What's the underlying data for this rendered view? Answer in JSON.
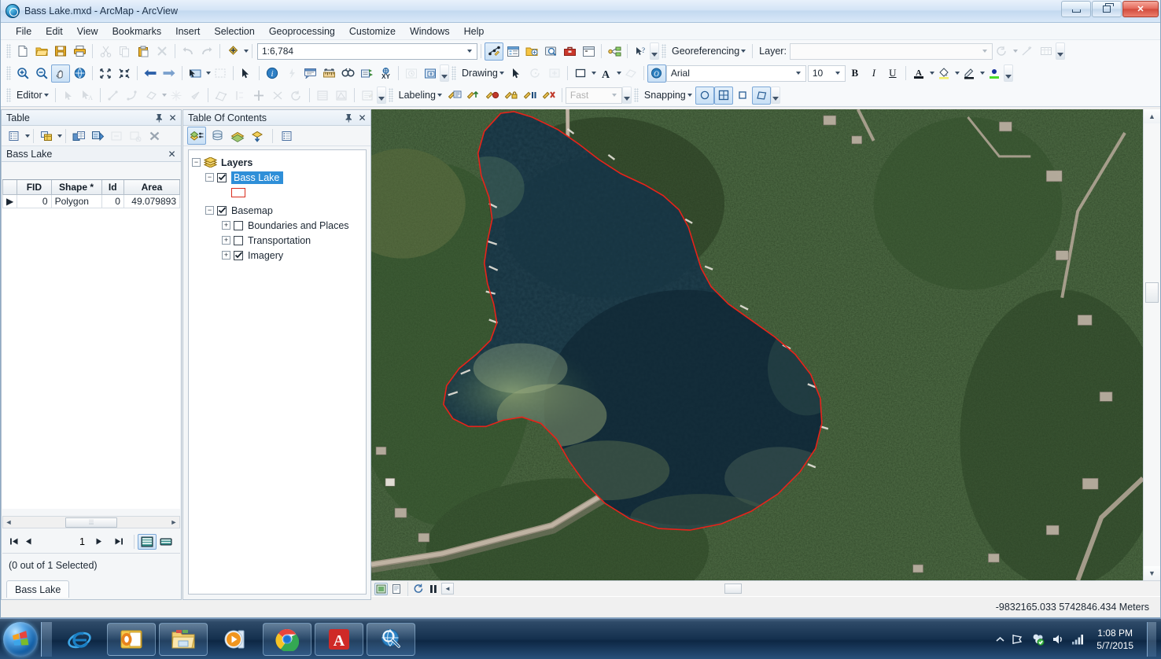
{
  "window": {
    "title": "Bass Lake.mxd - ArcMap - ArcView",
    "icon": "arcmap-globe-icon",
    "minimize_label": "Minimize",
    "maximize_label": "Restore",
    "close_label": "Close"
  },
  "menu": {
    "items": [
      "File",
      "Edit",
      "View",
      "Bookmarks",
      "Insert",
      "Selection",
      "Geoprocessing",
      "Customize",
      "Windows",
      "Help"
    ]
  },
  "toolbars": {
    "standard": {
      "scale_value": "1:6,784",
      "buttons": [
        "new-map-icon",
        "open-icon",
        "save-icon",
        "print-icon",
        "cut-icon",
        "copy-icon",
        "paste-icon",
        "delete-icon",
        "undo-icon",
        "redo-icon",
        "add-data-icon"
      ],
      "after_scale": [
        "editor-toolbar-icon",
        "table-of-contents-icon",
        "catalog-icon",
        "search-icon",
        "arctoolbox-icon",
        "python-window-icon",
        "model-builder-icon",
        "whats-this-icon"
      ]
    },
    "georeferencing": {
      "label": "Georeferencing",
      "layer_label": "Layer:",
      "layer_value": "",
      "buttons": [
        "rotate-icon",
        "link-icon",
        "link-table-icon"
      ]
    },
    "tools": {
      "buttons": [
        "zoom-in-icon",
        "zoom-out-icon",
        "pan-icon",
        "full-extent-icon",
        "fixed-zoom-in-icon",
        "fixed-zoom-out-icon",
        "go-back-icon",
        "go-forward-icon",
        "select-features-icon",
        "clear-selection-icon",
        "select-elements-icon",
        "identify-icon",
        "hyperlink-icon",
        "html-popup-icon",
        "measure-icon",
        "find-icon",
        "find-route-icon",
        "go-to-xy-icon",
        "time-slider-icon",
        "create-viewer-window-icon"
      ]
    },
    "drawing": {
      "label": "Drawing",
      "font_name": "Arial",
      "font_size": "10",
      "bold": "B",
      "italic": "I",
      "underline": "U",
      "buttons": [
        "select-elements-icon",
        "rotate-element-icon",
        "nudge-icon",
        "new-rectangle-icon",
        "new-text-icon",
        "clip-icon",
        "font-color-icon",
        "fill-color-icon",
        "line-color-icon",
        "marker-color-icon"
      ]
    },
    "editor": {
      "label": "Editor",
      "buttons": [
        "edit-tool-icon",
        "edit-annotation-icon",
        "straight-segment-icon",
        "endpoint-arc-icon",
        "trace-icon",
        "construct-points-icon",
        "mirror-features-icon",
        "split-polygons-icon",
        "reshape-icon",
        "split-icon",
        "rotate-icon",
        "clip-icon",
        "attributes-icon",
        "sketch-properties-icon",
        "create-features-icon"
      ]
    },
    "labeling": {
      "label": "Labeling",
      "quality_value": "Fast",
      "buttons": [
        "label-manager-icon",
        "label-priority-icon",
        "label-weight-icon",
        "lock-labels-icon",
        "pause-labeling-icon",
        "view-unplaced-labels-icon"
      ]
    },
    "snapping": {
      "label": "Snapping",
      "buttons": [
        "point-snapping-icon",
        "vertex-snapping-icon",
        "end-snapping-icon",
        "edge-snapping-icon"
      ]
    }
  },
  "table_panel": {
    "title": "Table",
    "pin_icon": "pin-icon",
    "close_icon": "close-icon",
    "toolbar_buttons": [
      "table-options-icon",
      "related-tables-icon",
      "select-by-attributes-icon",
      "switch-selection-icon",
      "zoom-to-selected-icon",
      "clear-selection-icon",
      "delete-selected-icon"
    ],
    "tab_label": "Bass Lake",
    "columns": [
      "FID",
      "Shape *",
      "Id",
      "Area"
    ],
    "rows": [
      {
        "selector": "▶",
        "FID": "0",
        "Shape": "Polygon",
        "Id": "0",
        "Area": "49.079893"
      }
    ],
    "record_number": "1",
    "selection_status": "(0 out of 1 Selected)",
    "bottom_tab": "Bass Lake",
    "nav_first": "first-record-icon",
    "nav_prev": "previous-record-icon",
    "nav_next": "next-record-icon",
    "nav_last": "last-record-icon",
    "view_table_icon": "table-view-icon",
    "view_selected_icon": "selected-view-icon"
  },
  "toc_panel": {
    "title": "Table Of Contents",
    "pin_icon": "pin-icon",
    "close_icon": "close-icon",
    "toolbar_buttons": [
      "list-by-drawing-order-icon",
      "list-by-source-icon",
      "list-by-visibility-icon",
      "list-by-selection-icon",
      "toc-options-icon"
    ],
    "tree": {
      "root": {
        "label": "Layers",
        "icon": "layers-icon",
        "expanded": true
      },
      "items": [
        {
          "label": "Bass Lake",
          "checked": true,
          "selected": true,
          "expanded": true,
          "symbol": "red-outline-square",
          "symbol_color": "#d92b1c",
          "indent": 1
        },
        {
          "label": "Basemap",
          "checked": true,
          "selected": false,
          "expanded": true,
          "indent": 1
        },
        {
          "label": "Boundaries and Places",
          "checked": false,
          "selected": false,
          "expanded": false,
          "indent": 2
        },
        {
          "label": "Transportation",
          "checked": false,
          "selected": false,
          "expanded": false,
          "indent": 2
        },
        {
          "label": "Imagery",
          "checked": true,
          "selected": false,
          "expanded": false,
          "indent": 2
        }
      ]
    }
  },
  "map": {
    "description": "Aerial imagery basemap showing Bass Lake with a red digitized polygon boundary",
    "polygon_color": "#e8231a",
    "water_color": "#17323f",
    "forest_color": "#2d4a26",
    "coordinates": "-9832165.033  5742846.434 Meters",
    "draw_buttons": [
      "pause-drawing-icon",
      "refresh-view-icon",
      "data-frame-icon",
      "continuous-refresh-icon"
    ]
  },
  "taskbar": {
    "start_label": "Start",
    "items": [
      {
        "name": "internet-explorer-icon",
        "label": "Internet Explorer"
      },
      {
        "name": "outlook-icon",
        "label": "Microsoft Outlook"
      },
      {
        "name": "file-explorer-icon",
        "label": "Windows Explorer"
      },
      {
        "name": "media-player-icon",
        "label": "Windows Media Player"
      },
      {
        "name": "chrome-icon",
        "label": "Google Chrome"
      },
      {
        "name": "acrobat-icon",
        "label": "Adobe Acrobat"
      },
      {
        "name": "arcmap-icon",
        "label": "ArcMap"
      }
    ],
    "tray_icons": [
      "show-hidden-icons-icon",
      "action-center-icon",
      "network-icon",
      "volume-icon",
      "signal-icon"
    ],
    "time": "1:08 PM",
    "date": "5/7/2015"
  }
}
